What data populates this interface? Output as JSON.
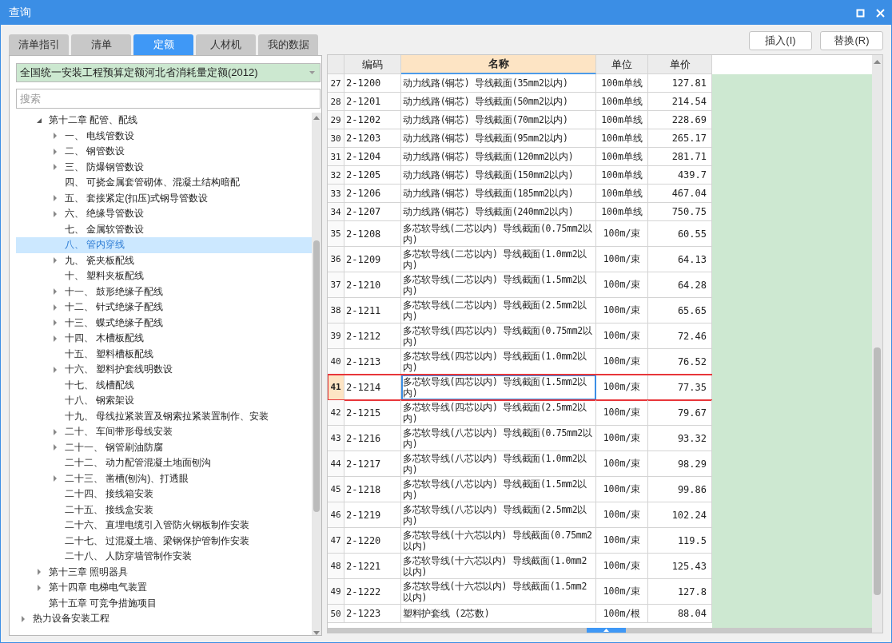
{
  "window": {
    "title": "查询"
  },
  "tabs": [
    {
      "label": "清单指引",
      "selected": false
    },
    {
      "label": "清单",
      "selected": false
    },
    {
      "label": "定额",
      "selected": true
    },
    {
      "label": "人材机",
      "selected": false
    },
    {
      "label": "我的数据",
      "selected": false
    }
  ],
  "library_dropdown": {
    "value": "全国统一安装工程预算定额河北省消耗量定额(2012)"
  },
  "search": {
    "placeholder": "搜索"
  },
  "tree": {
    "items": [
      {
        "children": [
          {
            "label": "第十二章 配管、配线",
            "expanded": true,
            "selected": false,
            "children": [
              {
                "label": "一、 电线管数设",
                "expanded": false,
                "selected": false
              },
              {
                "label": "二、 钢管数设",
                "expanded": false,
                "selected": false
              },
              {
                "label": "三、 防爆钢管数设",
                "expanded": false,
                "selected": false
              },
              {
                "label": "四、 可挠金属套管砌体、混凝土结构暗配",
                "selected": false
              },
              {
                "label": "五、 套接紧定(扣压)式钢导管数设",
                "expanded": false,
                "selected": false
              },
              {
                "label": "六、 绝缘导管数设",
                "expanded": false,
                "selected": false
              },
              {
                "label": "七、 金属软管数设",
                "selected": false
              },
              {
                "label": "八、 管内穿线",
                "selected": true
              },
              {
                "label": "九、 瓷夹板配线",
                "expanded": false,
                "selected": false
              },
              {
                "label": "十、 塑料夹板配线",
                "selected": false
              },
              {
                "label": "十一、 鼓形绝缘子配线",
                "expanded": false,
                "selected": false
              },
              {
                "label": "十二、 针式绝缘子配线",
                "expanded": false,
                "selected": false
              },
              {
                "label": "十三、 蝶式绝缘子配线",
                "expanded": false,
                "selected": false
              },
              {
                "label": "十四、 木槽板配线",
                "expanded": false,
                "selected": false
              },
              {
                "label": "十五、 塑料槽板配线",
                "selected": false
              },
              {
                "label": "十六、 塑料护套线明数设",
                "expanded": false,
                "selected": false
              },
              {
                "label": "十七、 线槽配线",
                "selected": false
              },
              {
                "label": "十八、 钢索架设",
                "selected": false
              },
              {
                "label": "十九、 母线拉紧装置及钢索拉紧装置制作、安装",
                "selected": false
              },
              {
                "label": "二十、 车间带形母线安装",
                "expanded": false,
                "selected": false
              },
              {
                "label": "二十一、 钢管刷油防腐",
                "expanded": false,
                "selected": false
              },
              {
                "label": "二十二、 动力配管混凝土地面刨沟",
                "selected": false
              },
              {
                "label": "二十三、 凿槽(刨沟)、打透眼",
                "expanded": false,
                "selected": false
              },
              {
                "label": "二十四、 接线箱安装",
                "selected": false
              },
              {
                "label": "二十五、 接线盒安装",
                "selected": false
              },
              {
                "label": "二十六、 直埋电缆引入管防火钢板制作安装",
                "selected": false
              },
              {
                "label": "二十七、 过混凝土墙、梁钢保护管制作安装",
                "selected": false
              },
              {
                "label": "二十八、 人防穿墙管制作安装",
                "selected": false
              }
            ]
          },
          {
            "label": "第十三章 照明器具",
            "expanded": false,
            "selected": false
          },
          {
            "label": "第十四章 电梯电气装置",
            "expanded": false,
            "selected": false
          },
          {
            "label": "第十五章 可竞争措施项目",
            "selected": false
          }
        ]
      },
      {
        "label": "热力设备安装工程",
        "expanded": false,
        "selected": false
      }
    ]
  },
  "buttons": [
    {
      "label": "插入(I)"
    },
    {
      "label": "替换(R)"
    }
  ],
  "table": {
    "columns": [
      {
        "label": "编码",
        "selected": false
      },
      {
        "label": "名称",
        "selected": true
      },
      {
        "label": "单位",
        "selected": false
      },
      {
        "label": "单价",
        "selected": false
      }
    ],
    "rows": [
      {
        "no": "27",
        "code": "2-1200",
        "name": "动力线路(铜芯) 导线截面(35mm2以内)",
        "unit": "100m单线",
        "price": "127.81",
        "selected": false,
        "highlighted": false
      },
      {
        "no": "28",
        "code": "2-1201",
        "name": "动力线路(铜芯) 导线截面(50mm2以内)",
        "unit": "100m单线",
        "price": "214.54",
        "selected": false,
        "highlighted": false
      },
      {
        "no": "29",
        "code": "2-1202",
        "name": "动力线路(铜芯) 导线截面(70mm2以内)",
        "unit": "100m单线",
        "price": "228.69",
        "selected": false,
        "highlighted": false
      },
      {
        "no": "30",
        "code": "2-1203",
        "name": "动力线路(铜芯) 导线截面(95mm2以内)",
        "unit": "100m单线",
        "price": "265.17",
        "selected": false,
        "highlighted": false
      },
      {
        "no": "31",
        "code": "2-1204",
        "name": "动力线路(铜芯) 导线截面(120mm2以内)",
        "unit": "100m单线",
        "price": "281.71",
        "selected": false,
        "highlighted": false
      },
      {
        "no": "32",
        "code": "2-1205",
        "name": "动力线路(铜芯) 导线截面(150mm2以内)",
        "unit": "100m单线",
        "price": "439.7",
        "selected": false,
        "highlighted": false
      },
      {
        "no": "33",
        "code": "2-1206",
        "name": "动力线路(铜芯) 导线截面(185mm2以内)",
        "unit": "100m单线",
        "price": "467.04",
        "selected": false,
        "highlighted": false
      },
      {
        "no": "34",
        "code": "2-1207",
        "name": "动力线路(铜芯) 导线截面(240mm2以内)",
        "unit": "100m单线",
        "price": "750.75",
        "selected": false,
        "highlighted": false
      },
      {
        "no": "35",
        "code": "2-1208",
        "name": "多芯软导线(二芯以内) 导线截面(0.75mm2以内)",
        "unit": "100m/束",
        "price": "60.55",
        "selected": false,
        "highlighted": false
      },
      {
        "no": "36",
        "code": "2-1209",
        "name": "多芯软导线(二芯以内) 导线截面(1.0mm2以内)",
        "unit": "100m/束",
        "price": "64.13",
        "selected": false,
        "highlighted": false
      },
      {
        "no": "37",
        "code": "2-1210",
        "name": "多芯软导线(二芯以内) 导线截面(1.5mm2以内)",
        "unit": "100m/束",
        "price": "64.28",
        "selected": false,
        "highlighted": false
      },
      {
        "no": "38",
        "code": "2-1211",
        "name": "多芯软导线(二芯以内) 导线截面(2.5mm2以内)",
        "unit": "100m/束",
        "price": "65.65",
        "selected": false,
        "highlighted": false
      },
      {
        "no": "39",
        "code": "2-1212",
        "name": "多芯软导线(四芯以内) 导线截面(0.75mm2以内)",
        "unit": "100m/束",
        "price": "72.46",
        "selected": false,
        "highlighted": false
      },
      {
        "no": "40",
        "code": "2-1213",
        "name": "多芯软导线(四芯以内) 导线截面(1.0mm2以内)",
        "unit": "100m/束",
        "price": "76.52",
        "selected": false,
        "highlighted": false
      },
      {
        "no": "41",
        "code": "2-1214",
        "name": "多芯软导线(四芯以内) 导线截面(1.5mm2以内)",
        "unit": "100m/束",
        "price": "77.35",
        "selected": true,
        "highlighted": true
      },
      {
        "no": "42",
        "code": "2-1215",
        "name": "多芯软导线(四芯以内) 导线截面(2.5mm2以内)",
        "unit": "100m/束",
        "price": "79.67",
        "selected": false,
        "highlighted": false
      },
      {
        "no": "43",
        "code": "2-1216",
        "name": "多芯软导线(八芯以内) 导线截面(0.75mm2以内)",
        "unit": "100m/束",
        "price": "93.32",
        "selected": false,
        "highlighted": false
      },
      {
        "no": "44",
        "code": "2-1217",
        "name": "多芯软导线(八芯以内) 导线截面(1.0mm2以内)",
        "unit": "100m/束",
        "price": "98.29",
        "selected": false,
        "highlighted": false
      },
      {
        "no": "45",
        "code": "2-1218",
        "name": "多芯软导线(八芯以内) 导线截面(1.5mm2以内)",
        "unit": "100m/束",
        "price": "99.86",
        "selected": false,
        "highlighted": false
      },
      {
        "no": "46",
        "code": "2-1219",
        "name": "多芯软导线(八芯以内) 导线截面(2.5mm2以内)",
        "unit": "100m/束",
        "price": "102.24",
        "selected": false,
        "highlighted": false
      },
      {
        "no": "47",
        "code": "2-1220",
        "name": "多芯软导线(十六芯以内) 导线截面(0.75mm2以内)",
        "unit": "100m/束",
        "price": "119.5",
        "selected": false,
        "highlighted": false
      },
      {
        "no": "48",
        "code": "2-1221",
        "name": "多芯软导线(十六芯以内) 导线截面(1.0mm2以内)",
        "unit": "100m/束",
        "price": "125.43",
        "selected": false,
        "highlighted": false
      },
      {
        "no": "49",
        "code": "2-1222",
        "name": "多芯软导线(十六芯以内) 导线截面(1.5mm2以内)",
        "unit": "100m/束",
        "price": "127.8",
        "selected": false,
        "highlighted": false
      },
      {
        "no": "50",
        "code": "2-1223",
        "name": "塑料护套线 (2芯数)",
        "unit": "100m/根",
        "price": "88.04",
        "selected": false,
        "highlighted": false
      }
    ]
  }
}
